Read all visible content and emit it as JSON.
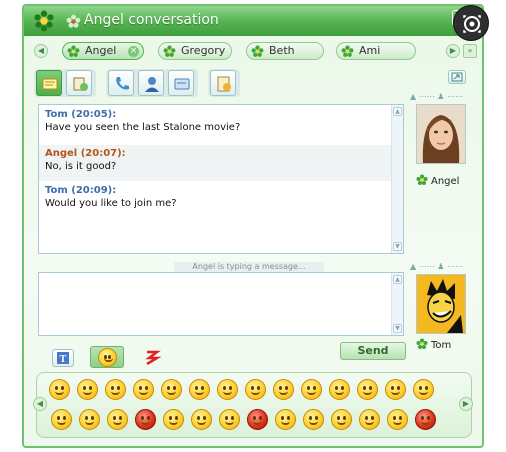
{
  "window": {
    "title": "Angel conversation"
  },
  "tabs": [
    {
      "label": "Angel",
      "active": true
    },
    {
      "label": "Gregory",
      "active": false
    },
    {
      "label": "Beth",
      "active": false
    },
    {
      "label": "Ami",
      "active": false
    }
  ],
  "toolbar": {
    "groups": [
      [
        "message-icon",
        "file-transfer-icon"
      ],
      [
        "phone-icon",
        "contact-icon",
        "card-icon"
      ],
      [
        "history-icon"
      ]
    ]
  },
  "messages": [
    {
      "author": "Tom (20:05):",
      "text": "Have you seen the last Stalone movie?",
      "self": true
    },
    {
      "author": "Angel (20:07):",
      "text": "No, is it good?",
      "self": false
    },
    {
      "author": "Tom (20:09):",
      "text": "Would you like to join me?",
      "self": true
    }
  ],
  "status": {
    "typing": "Angel is typing a message..."
  },
  "contact": {
    "name": "Angel"
  },
  "me": {
    "name": "Tom"
  },
  "compose": {
    "value": "",
    "send_label": "Send"
  },
  "format_buttons": [
    "text-format-icon",
    "smiley-picker-icon",
    "nudge-icon"
  ],
  "colors": {
    "title_green": "#53b24f",
    "accent_blue": "#3d6ea8",
    "other_author": "#b0551c"
  },
  "smileys": {
    "row1": [
      "smile",
      "grin",
      "sad",
      "surprised",
      "neutral",
      "cool",
      "laugh",
      "cheers",
      "kiss",
      "tongue",
      "wink",
      "sick",
      "blink",
      "angry"
    ],
    "row2": [
      "happy",
      "blush",
      "confused",
      "devil",
      "shy",
      "flower-holder",
      "nervous",
      "explode",
      "crazy",
      "thumbs-up",
      "doh",
      "beer",
      "sleep",
      "love"
    ]
  }
}
